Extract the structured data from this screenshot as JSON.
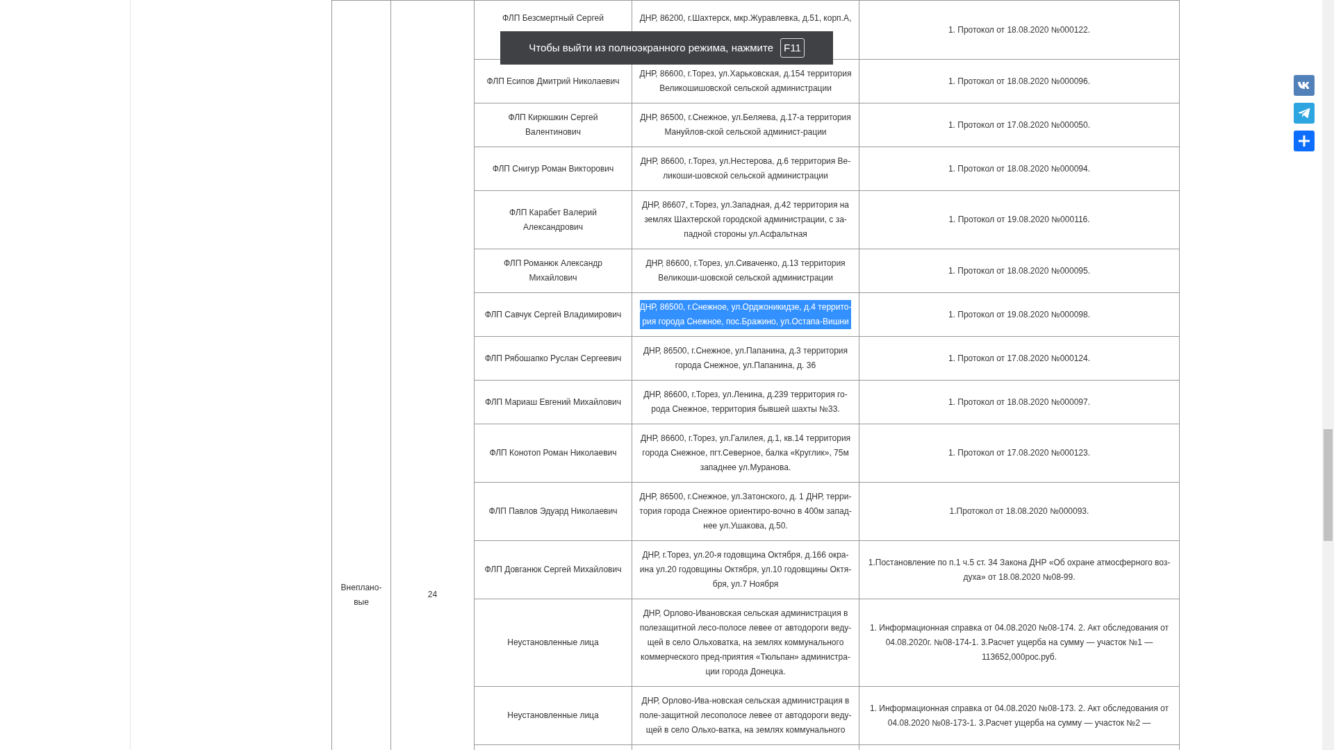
{
  "fullscreen_notice": {
    "text": "Чтобы выйти из полноэкранного режима, нажмите",
    "key": "F11"
  },
  "group": {
    "category": "Внеплано-\nвые",
    "count": "24"
  },
  "rows": [
    {
      "name": "ФЛП Безсмертный Сергей",
      "address": "ДНР, 86200, г.Шахтерск, мкр.Журавлевка, д.51, корп.А,",
      "documents": "1. Протокол от 18.08.2020 №000122.",
      "highlighted": false
    },
    {
      "name": "ФЛП Есипов Дмитрий Николаевич",
      "address": "ДНР, 86600, г.Торез, ул.Харьковская, д.154 территория\nВеликошишовской сельской администрации",
      "documents": "1. Протокол от 18.08.2020 №000096.",
      "highlighted": false
    },
    {
      "name": "ФЛП Кирюшкин Сергей\nВалентинович",
      "address": "ДНР, 86500, г.Снежное, ул.Беляева, д.17-а территория\nМануйлов-ской сельской админист-рации",
      "documents": "1. Протокол от 17.08.2020 №000050.",
      "highlighted": false
    },
    {
      "name": "ФЛП Снигур Роман Викторович",
      "address": "ДНР, 86600, г.Торез, ул.Нестерова, д.6 территория Ве-\nликоши-шовской сельской администрации",
      "documents": "1. Протокол от 18.08.2020 №000094.",
      "highlighted": false
    },
    {
      "name": "ФЛП Карабет Валерий\nАлександрович",
      "address": "ДНР, 86607, г.Торез, ул.Западная, д.42 территория на\nземлях Шахтерской городской администрации, с за-\nпадной стороны ул.Асфальтная",
      "documents": "1. Протокол от 19.08.2020 №000116.",
      "highlighted": false
    },
    {
      "name": "ФЛП Романюк Александр\nМихайлович",
      "address": "ДНР, 86600, г.Торез, ул.Сиваченко, д.13 территория\nВеликоши-шовской сельской администрации",
      "documents": "1. Протокол от 18.08.2020 №000095.",
      "highlighted": false
    },
    {
      "name": "ФЛП Савчук Сергей Владимирович",
      "address": "ДНР, 86500, г.Снежное, ул.Орджоникидзе, д.4 террито-\nрия города Снежное, пос.Бражино, ул.Остапа-Вишни",
      "documents": "1. Протокол от 19.08.2020 №000098.",
      "highlighted": true
    },
    {
      "name": "ФЛП Рябошапко Руслан Сергеевич",
      "address": "ДНР, 86500, г.Снежное, ул.Папанина, д.3 территория\nгорода Снежное, ул.Папанина, д. 36",
      "documents": "1. Протокол от 17.08.2020 №000124.",
      "highlighted": false
    },
    {
      "name": "ФЛП Мариаш Евгений Михайлович",
      "address": "ДНР, 86600, г.Торез, ул.Ленина, д.239 территория го-\nрода Снежное, территория бывшей шахты №33.",
      "documents": "1. Протокол от 18.08.2020 №000097.",
      "highlighted": false
    },
    {
      "name": "ФЛП Конотоп Роман Николаевич",
      "address": "ДНР, 86600, г.Торез, ул.Галилея, д.1, кв.14 территория\nгорода Снежное, пгт.Северное, балка «Круглик», 75м\nзападнее ул.Муранова.",
      "documents": "1. Протокол от 17.08.2020 №000123.",
      "highlighted": false
    },
    {
      "name": "ФЛП Павлов Эдуард Николаевич",
      "address": "ДНР, 86500, г.Снежное, ул.Затонского, д. 1 ДНР, терри-\nтория города Снежное ориентиро-вочно в 400м запад-\nнее ул.Ушакова, д.50.",
      "documents": "1.Протокол от 18.08.2020 №000093.",
      "highlighted": false
    },
    {
      "name": "ФЛП Довганюк Сергей Михайлович",
      "address": "ДНР, г.Торез, ул.20-я годовщина Октября, д.166 окра-\nина ул.20 годовщины Октября, ул.10 годовщины Октя-\nбря, ул.7 Ноября",
      "documents": "1.Постановление по п.1 ч.5 ст. 34 Закона ДНР «Об охране атмосферного воз-\nдуха» от 18.08.2020 №08-99.",
      "highlighted": false
    },
    {
      "name": "Неустановленные лица",
      "address": "ДНР, Орлово-Ивановская сельская администрация в\nполезащитной лесо-полосе левее от автодороги веду-\nщей в село Ольховатка, на землях коммунального\nкоммерческого пред-приятия «Тюльпан» администра-\nции города Донецка.",
      "documents": "1. Информационная справка от 04.08.2020 №08-174. 2. Акт обследования от\n04.08.2020г. №08-174-1. 3.Расчет ущерба на сумму — участок №1 —\n113652,000рос.руб.",
      "highlighted": false
    },
    {
      "name": "Неустановленные лица",
      "address": "ДНР, Орлово-Ива-новская сельская администрация в\nполе-защитной лесополосе левее от автодороги веду-\nщей в село Ольхо-ватка, на землях коммунального",
      "documents": "1. Информационная справка от 04.08.2020 №08-173. 2. Акт обследования от\n04.08.2020 №08-173-1. 3.Расчет ущерба на сумму — участок №2 —",
      "highlighted": false
    }
  ]
}
